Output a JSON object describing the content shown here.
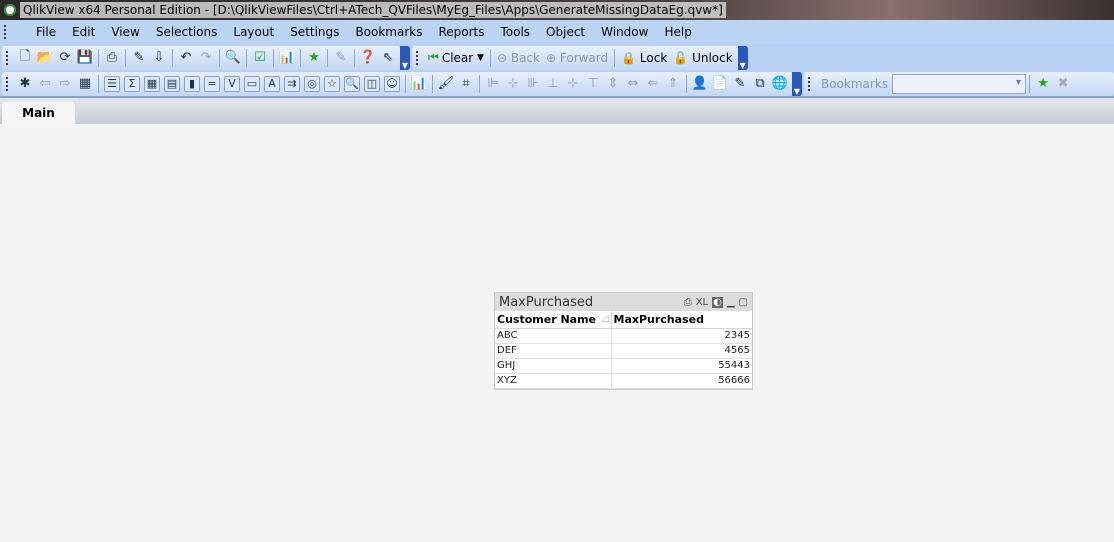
{
  "window": {
    "title": "QlikView x64 Personal Edition - [D:\\QlikViewFiles\\Ctrl+ATech_QVFiles\\MyEg_Files\\Apps\\GenerateMissingDataEg.qvw*]"
  },
  "menu": [
    "File",
    "Edit",
    "View",
    "Selections",
    "Layout",
    "Settings",
    "Bookmarks",
    "Reports",
    "Tools",
    "Object",
    "Window",
    "Help"
  ],
  "toolbar": {
    "clear": "Clear",
    "back": "Back",
    "forward": "Forward",
    "lock": "Lock",
    "unlock": "Unlock",
    "bookmarks_label": "Bookmarks",
    "bookmarks_value": ""
  },
  "tabs": [
    {
      "label": "Main",
      "active": true
    }
  ],
  "table_box": {
    "title": "MaxPurchased",
    "xl": "XL",
    "columns": [
      "Customer Name",
      "MaxPurchased"
    ],
    "rows": [
      [
        "ABC",
        "2345"
      ],
      [
        "DEF",
        "4565"
      ],
      [
        "GHJ",
        "55443"
      ],
      [
        "XYZ",
        "56666"
      ]
    ]
  }
}
